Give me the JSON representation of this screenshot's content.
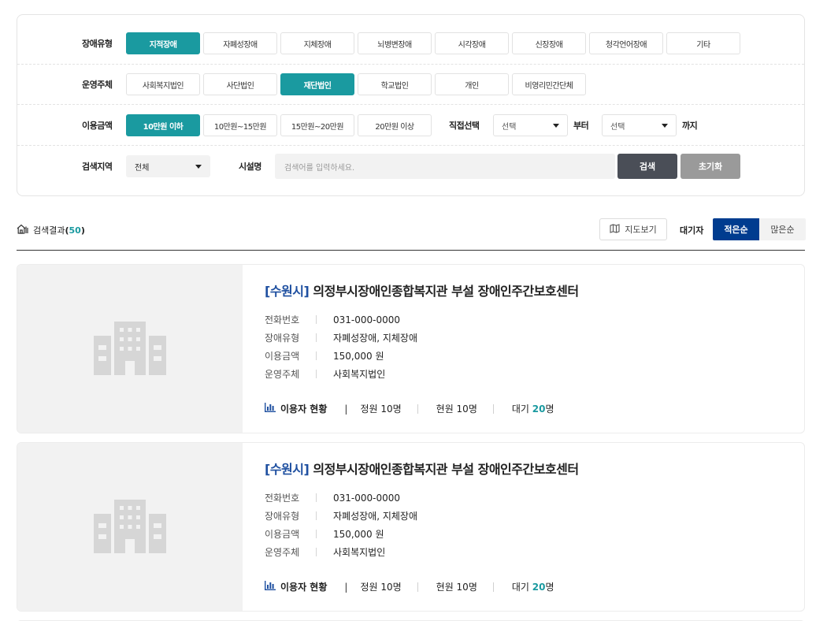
{
  "filters": {
    "disability_type": {
      "label": "장애유형",
      "options": [
        "지적장애",
        "자폐성장애",
        "지체장애",
        "뇌병변장애",
        "시각장애",
        "신장장애",
        "청각언어장애",
        "기타"
      ],
      "selected": "지적장애"
    },
    "operator": {
      "label": "운영주체",
      "options": [
        "사회복지법인",
        "사단법인",
        "재단법인",
        "학교법인",
        "개인",
        "비영리민간단체"
      ],
      "selected": "재단법인"
    },
    "fee": {
      "label": "이용금액",
      "options": [
        "10만원 이하",
        "10만원~15만원",
        "15만원~20만원",
        "20만원 이상"
      ],
      "selected": "10만원 이하",
      "direct_label": "직접선택",
      "from_value": "선택",
      "from_suffix": "부터",
      "to_value": "선택",
      "to_suffix": "까지"
    },
    "region": {
      "label": "검색지역",
      "value": "전체",
      "facility_label": "시설명",
      "facility_placeholder": "검색어를 입력하세요.",
      "search_label": "검색",
      "reset_label": "초기화"
    }
  },
  "results": {
    "title": "검색결과",
    "count": "50",
    "map_label": "지도보기",
    "wait_label": "대기자",
    "sort_asc": "적은순",
    "sort_desc": "많은순",
    "sort_selected": "적은순"
  },
  "cards": [
    {
      "region": "[수원시]",
      "name": "의정부시장애인종합복지관 부설 장애인주간보호센터",
      "phone_key": "전화번호",
      "phone": "031-000-0000",
      "type_key": "장애유형",
      "type": "자폐성장애, 지체장애",
      "fee_key": "이용금액",
      "fee": "150,000 원",
      "operator_key": "운영주체",
      "operator": "사회복지법인",
      "status_title": "이용자 현황",
      "capacity": "정원 10명",
      "current": "현원 10명",
      "waiting_prefix": "대기 ",
      "waiting_num": "20",
      "waiting_suffix": "명"
    },
    {
      "region": "[수원시]",
      "name": "의정부시장애인종합복지관 부설 장애인주간보호센터",
      "phone_key": "전화번호",
      "phone": "031-000-0000",
      "type_key": "장애유형",
      "type": "자폐성장애, 지체장애",
      "fee_key": "이용금액",
      "fee": "150,000 원",
      "operator_key": "운영주체",
      "operator": "사회복지법인",
      "status_title": "이용자 현황",
      "capacity": "정원 10명",
      "current": "현원 10명",
      "waiting_prefix": "대기 ",
      "waiting_num": "20",
      "waiting_suffix": "명"
    }
  ],
  "colors": {
    "accent_teal": "#1a9aa0",
    "sort_active": "#003c8f",
    "region_blue": "#1e4fa0",
    "search_button": "#4a4e57",
    "reset_button": "#9a9a9a"
  },
  "icons": {
    "results": "home-list-icon",
    "map": "map-icon",
    "status": "bar-chart-icon",
    "thumbnail": "building-placeholder-icon"
  }
}
